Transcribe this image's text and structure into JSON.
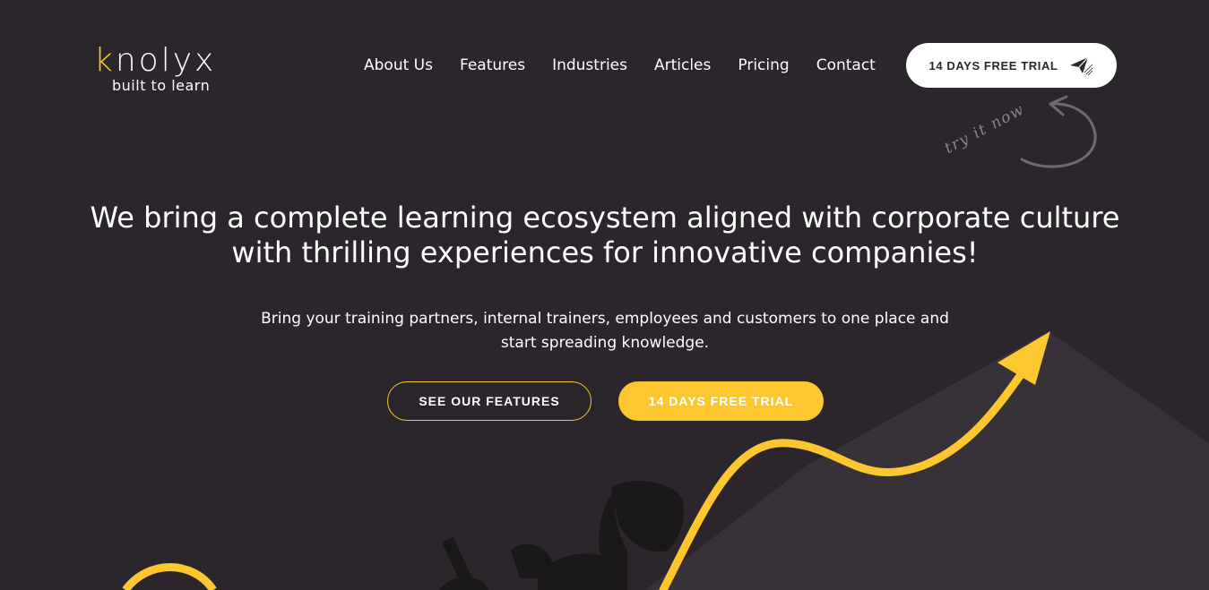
{
  "logo": {
    "word": "knolyx",
    "tagline": "built to learn"
  },
  "nav": {
    "items": [
      {
        "label": "About Us"
      },
      {
        "label": "Features"
      },
      {
        "label": "Industries"
      },
      {
        "label": "Articles"
      },
      {
        "label": "Pricing"
      },
      {
        "label": "Contact"
      }
    ]
  },
  "header_cta": {
    "label": "14 DAYS FREE TRIAL",
    "icon": "paper-plane-icon"
  },
  "try_it": "try it now",
  "hero": {
    "title": "We bring a complete learning ecosystem aligned with corporate culture with thrilling experiences for innovative companies!",
    "subtitle": "Bring your training partners, internal trainers, employees and customers to one place and start spreading knowledge.",
    "buttons": {
      "features": "SEE OUR FEATURES",
      "trial": "14 DAYS FREE TRIAL"
    }
  },
  "colors": {
    "background": "#2b262c",
    "accent": "#fdc82f",
    "white": "#ffffff",
    "muted": "#8a8590"
  }
}
